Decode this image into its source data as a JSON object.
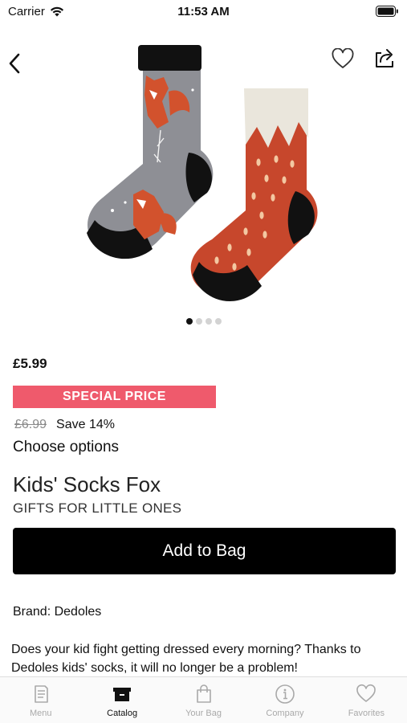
{
  "status_bar": {
    "carrier": "Carrier",
    "time": "11:53 AM"
  },
  "icons": {
    "back": "chevron-left-icon",
    "favorite": "heart-icon",
    "share": "share-icon"
  },
  "gallery": {
    "image": "kids-socks-fox-photo",
    "page_count": 4,
    "current_page": 1
  },
  "product": {
    "price": "£5.99",
    "badge": "SPECIAL PRICE",
    "old_price": "£6.99",
    "save": "Save 14%",
    "choose_options": "Choose options",
    "name": "Kids' Socks Fox",
    "category": "GIFTS FOR LITTLE ONES",
    "add_to_bag": "Add to Bag",
    "brand": "Brand: Dedoles",
    "description": "Does your kid fight getting dressed every morning? Thanks to Dedoles kids' socks, it will no longer be a problem!"
  },
  "tab_bar": {
    "active": "Catalog",
    "items": [
      {
        "label": "Menu",
        "icon": "menu-book-icon"
      },
      {
        "label": "Catalog",
        "icon": "catalog-box-icon"
      },
      {
        "label": "Your Bag",
        "icon": "bag-icon"
      },
      {
        "label": "Company",
        "icon": "info-icon"
      },
      {
        "label": "Favorites",
        "icon": "heart-icon"
      }
    ]
  },
  "colors": {
    "badge": "#ef5a6c",
    "button": "#000000",
    "tab_inactive": "#a9a9a9"
  }
}
